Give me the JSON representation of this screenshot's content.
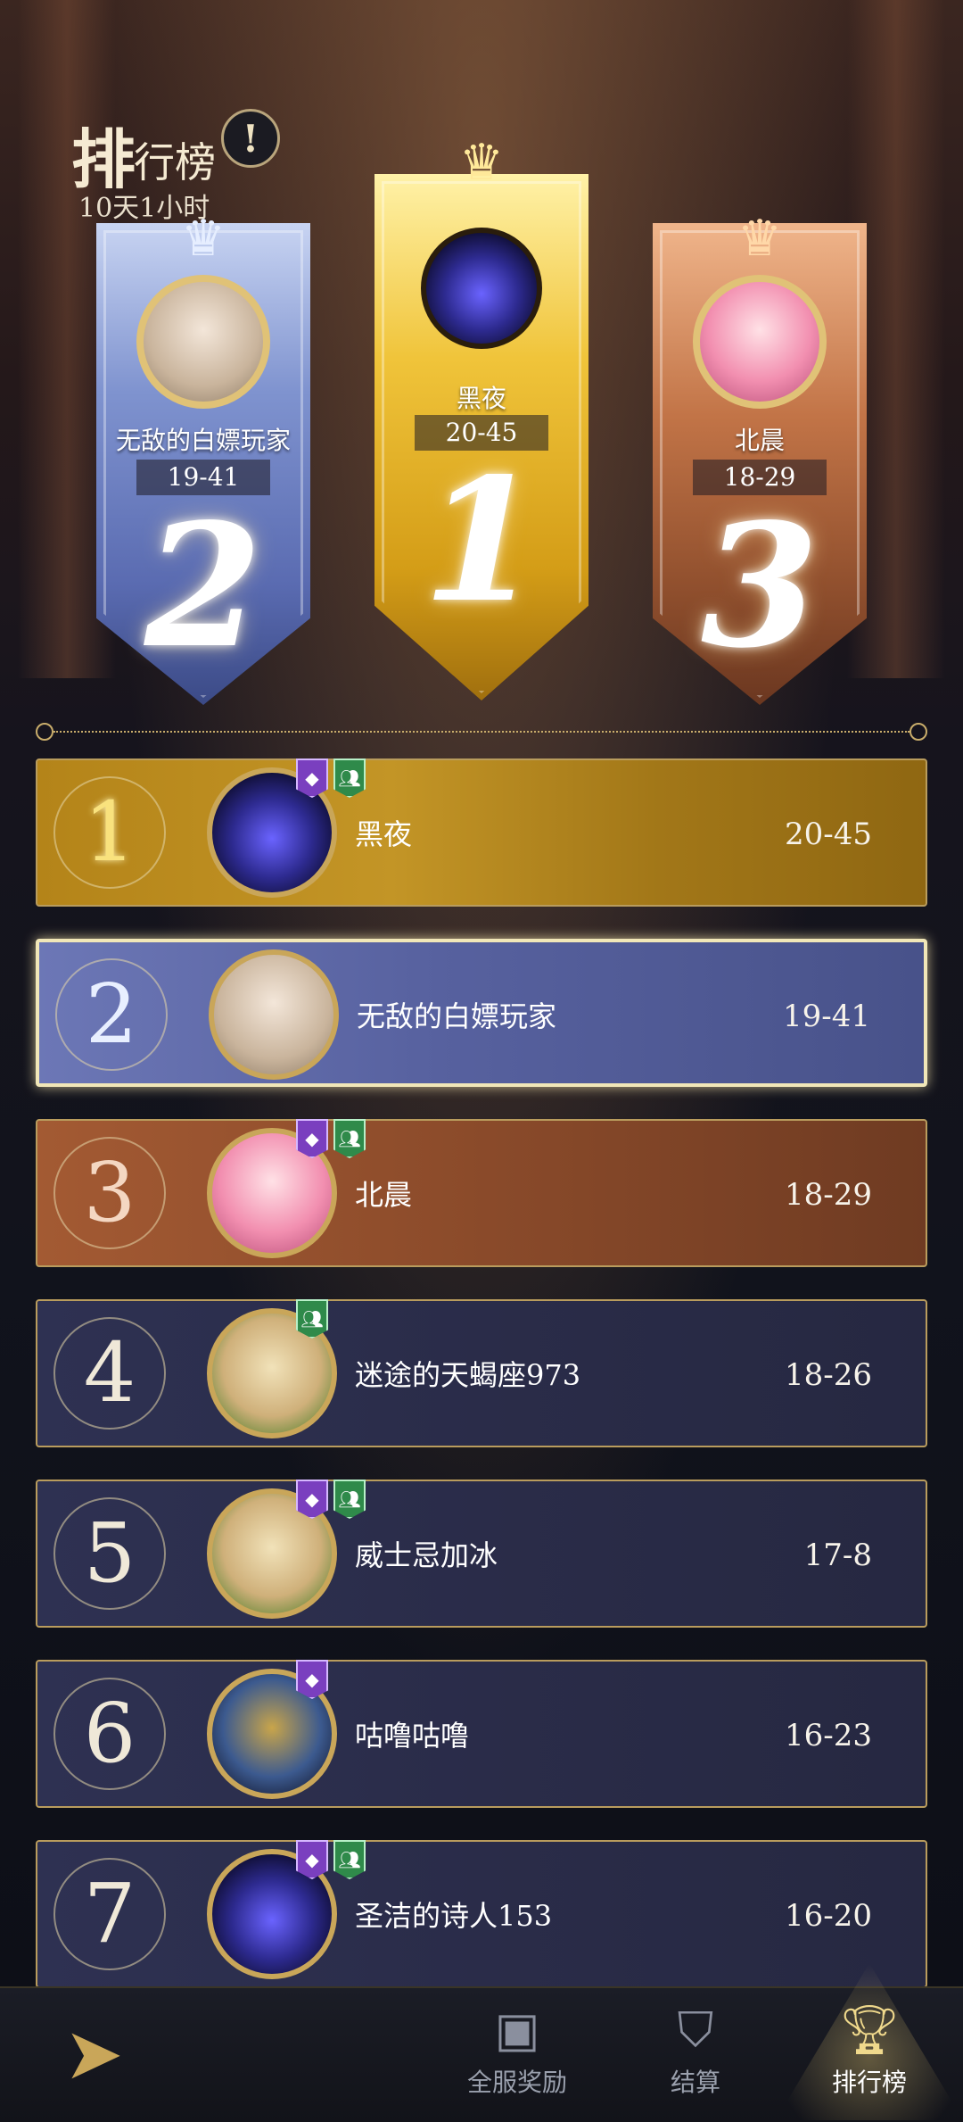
{
  "header": {
    "title_big": "排",
    "title_rest": "行榜",
    "countdown": "10天1小时",
    "info_icon": "exclamation-icon"
  },
  "podium": [
    {
      "rank": "2",
      "name": "无敌的白嫖玩家",
      "score": "19-41",
      "tier": "silver"
    },
    {
      "rank": "1",
      "name": "黑夜",
      "score": "20-45",
      "tier": "gold"
    },
    {
      "rank": "3",
      "name": "北晨",
      "score": "18-29",
      "tier": "bronze"
    }
  ],
  "rows": [
    {
      "rank": "1",
      "name": "黑夜",
      "score": "20-45",
      "style": "gold",
      "badges": [
        "purple",
        "green"
      ]
    },
    {
      "rank": "2",
      "name": "无敌的白嫖玩家",
      "score": "19-41",
      "style": "silver",
      "badges": []
    },
    {
      "rank": "3",
      "name": "北晨",
      "score": "18-29",
      "style": "bronze",
      "badges": [
        "purple",
        "green"
      ]
    },
    {
      "rank": "4",
      "name": "迷途的天蝎座973",
      "score": "18-26",
      "style": "plain",
      "badges": [
        "green"
      ]
    },
    {
      "rank": "5",
      "name": "威士忌加冰",
      "score": "17-8",
      "style": "plain",
      "badges": [
        "purple",
        "green"
      ]
    },
    {
      "rank": "6",
      "name": "咕噜咕噜",
      "score": "16-23",
      "style": "plain",
      "badges": [
        "purple"
      ]
    },
    {
      "rank": "7",
      "name": "圣洁的诗人153",
      "score": "16-20",
      "style": "plain",
      "badges": [
        "purple",
        "green"
      ]
    }
  ],
  "nav": {
    "back_icon": "back-arrow-icon",
    "items": [
      {
        "label": "全服奖励",
        "icon": "treasure-chest-icon",
        "active": false
      },
      {
        "label": "结算",
        "icon": "emblem-icon",
        "active": false
      },
      {
        "label": "排行榜",
        "icon": "trophy-icon",
        "active": true
      }
    ]
  },
  "colors": {
    "gold": "#c39526",
    "silver": "#57619f",
    "bronze": "#8d4c2b",
    "plain": "#2a2c49",
    "accent": "#c9a659"
  }
}
